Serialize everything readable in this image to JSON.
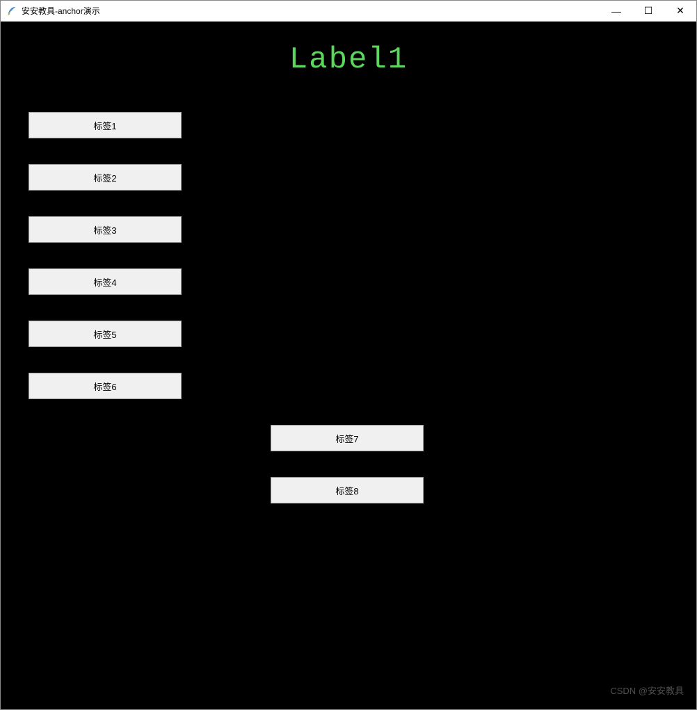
{
  "window": {
    "title": "安安教具-anchor演示",
    "icon_name": "feather-icon"
  },
  "titlebar_controls": {
    "minimize": "—",
    "maximize": "☐",
    "close": "✕"
  },
  "main_label": "Label1",
  "labels": [
    {
      "text": "标签1"
    },
    {
      "text": "标签2"
    },
    {
      "text": "标签3"
    },
    {
      "text": "标签4"
    },
    {
      "text": "标签5"
    },
    {
      "text": "标签6"
    },
    {
      "text": "标签7"
    },
    {
      "text": "标签8"
    }
  ],
  "watermark": "CSDN @安安教具",
  "colors": {
    "background": "#000000",
    "label_bg": "#f0f0f0",
    "main_label_color": "#5cd65c"
  }
}
